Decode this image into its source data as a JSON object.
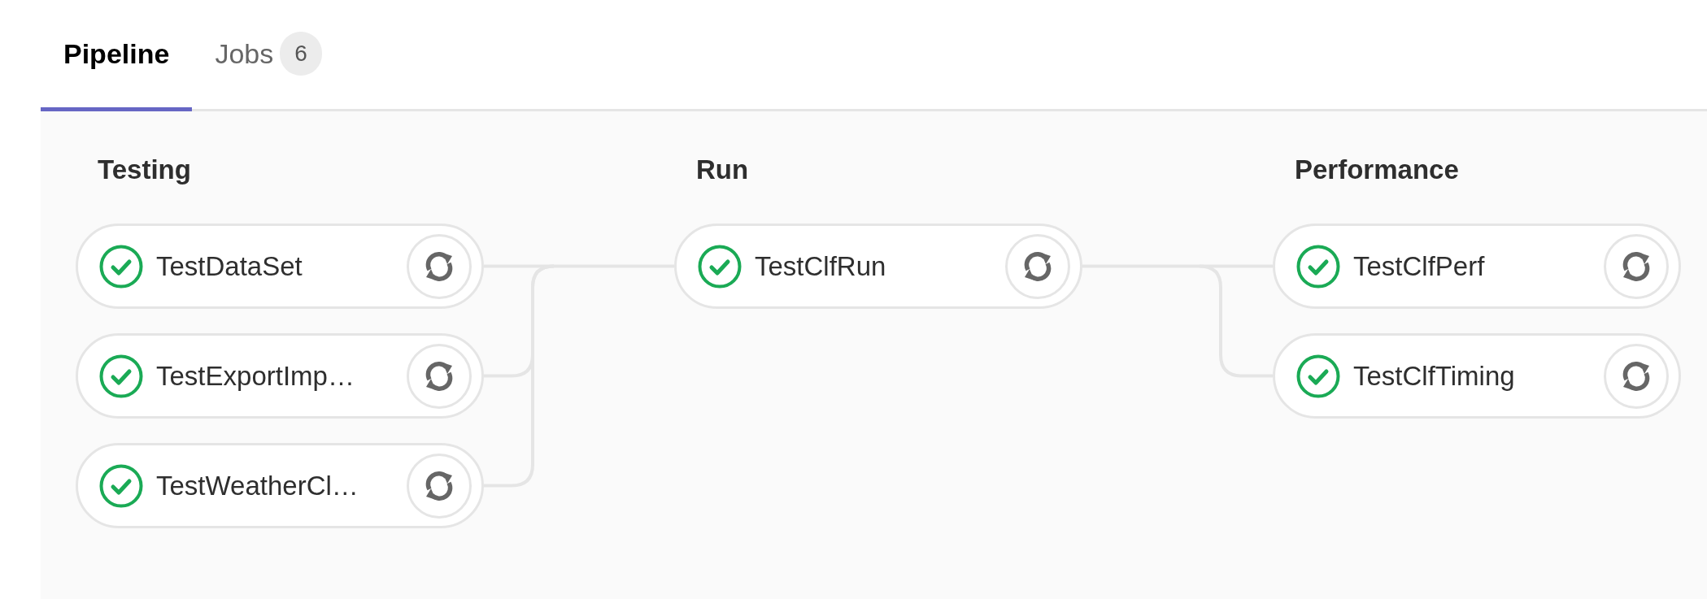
{
  "tabs": [
    {
      "label": "Pipeline",
      "selected": true
    },
    {
      "label": "Jobs",
      "count": "6",
      "selected": false
    }
  ],
  "stages": [
    {
      "title": "Testing",
      "jobs": [
        {
          "name": "TestDataSet",
          "passed": true
        },
        {
          "name": "TestExportImp…",
          "passed": true
        },
        {
          "name": "TestWeatherCl…",
          "passed": true
        }
      ]
    },
    {
      "title": "Run",
      "jobs": [
        {
          "name": "TestClfRun",
          "passed": true
        }
      ]
    },
    {
      "title": "Performance",
      "jobs": [
        {
          "name": "TestClfPerf",
          "passed": true
        },
        {
          "name": "TestClfTiming",
          "passed": true
        }
      ]
    }
  ]
}
